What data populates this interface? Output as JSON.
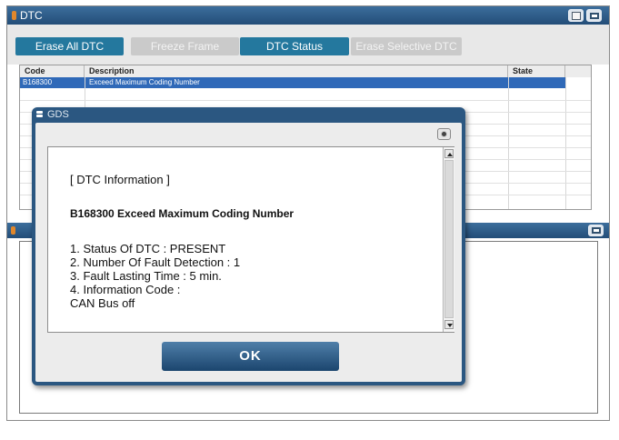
{
  "window": {
    "title": "DTC"
  },
  "toolbar": {
    "erase_all": "Erase All DTC",
    "freeze_frame": "Freeze Frame",
    "dtc_status": "DTC Status",
    "erase_selective": "Erase Selective DTC"
  },
  "table": {
    "headers": {
      "code": "Code",
      "description": "Description",
      "state": "State"
    },
    "rows": [
      {
        "code": "B168300",
        "description": "Exceed Maximum Coding Number",
        "state": ""
      }
    ]
  },
  "dialog": {
    "title": "GDS",
    "message": {
      "header": "[ DTC Information ]",
      "dtc_line": "B168300 Exceed Maximum Coding Number",
      "lines": [
        "1. Status Of DTC : PRESENT",
        "2. Number Of Fault Detection : 1",
        "3. Fault Lasting Time : 5 min.",
        "4. Information Code :",
        "CAN Bus off"
      ]
    },
    "ok_label": "OK"
  },
  "colors": {
    "titlebar": "#2b5781",
    "toolbar_button_active": "#24789e",
    "toolbar_button_disabled": "#cacaca",
    "selected_row": "#2f69b8",
    "accent_orange": "#e0872c"
  },
  "icons": [
    "print-icon",
    "restore-icon",
    "menu-icon",
    "close-icon",
    "scroll-up-icon",
    "scroll-down-icon"
  ]
}
